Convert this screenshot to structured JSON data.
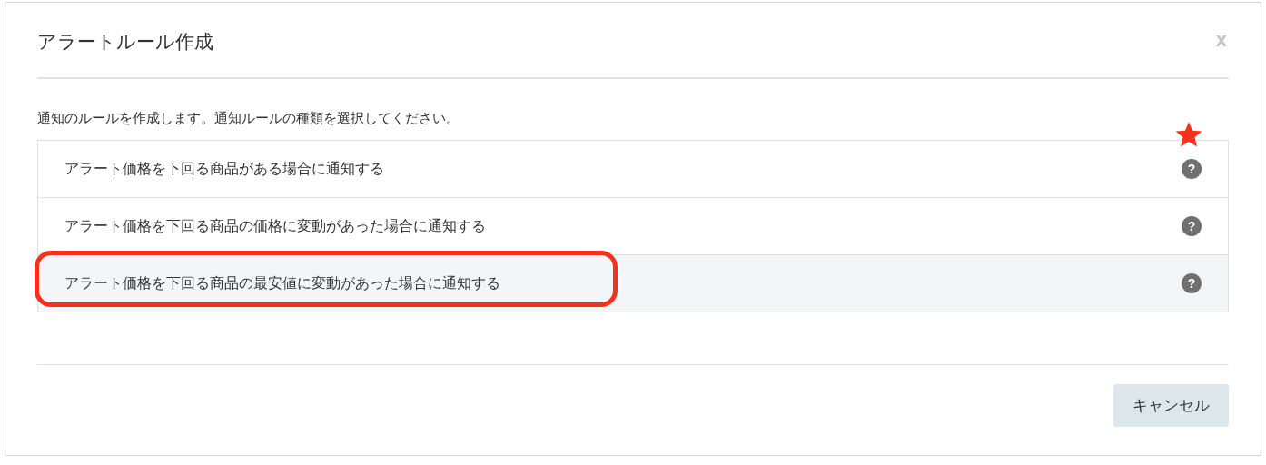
{
  "dialog": {
    "title": "アラートルール作成",
    "close": "x"
  },
  "description": "通知のルールを作成します。通知ルールの種類を選択してください。",
  "options": [
    {
      "label": "アラート価格を下回る商品がある場合に通知する",
      "selected": false,
      "circled": false,
      "starred": true,
      "help": "?"
    },
    {
      "label": "アラート価格を下回る商品の価格に変動があった場合に通知する",
      "selected": false,
      "circled": false,
      "starred": false,
      "help": "?"
    },
    {
      "label": "アラート価格を下回る商品の最安値に変動があった場合に通知する",
      "selected": true,
      "circled": true,
      "starred": false,
      "help": "?"
    }
  ],
  "buttons": [
    {
      "label": "キャンセル"
    }
  ]
}
